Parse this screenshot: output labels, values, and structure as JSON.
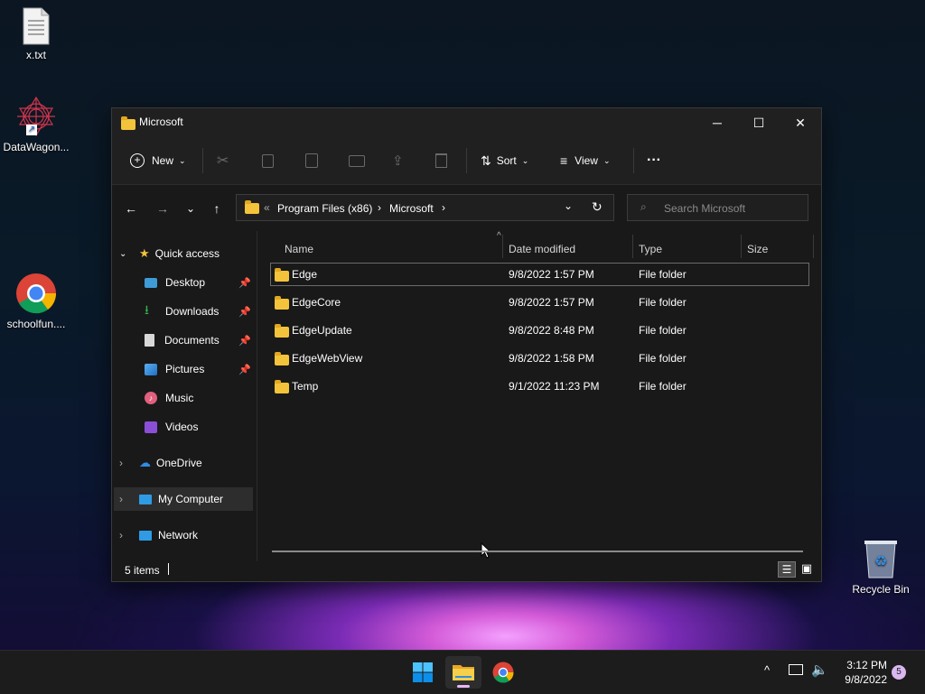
{
  "desktop": {
    "icons": [
      {
        "label": "x.txt",
        "icon": "text-file-icon"
      },
      {
        "label": "DataWagon...",
        "icon": "datawagon-shortcut-icon"
      },
      {
        "label": "schoolfun....",
        "icon": "chrome-icon"
      },
      {
        "label": "Recycle Bin",
        "icon": "recycle-bin-icon"
      }
    ]
  },
  "window": {
    "title": "Microsoft",
    "controls": {
      "minimize": "─",
      "maximize": "☐",
      "close": "✕"
    }
  },
  "commandbar": {
    "new_label": "New",
    "sort_label": "Sort",
    "view_label": "View",
    "more_label": "···"
  },
  "navigation": {
    "back": "←",
    "forward": "→",
    "recent": "⌄",
    "up": "↑",
    "breadcrumb": [
      "Program Files (x86)",
      "Microsoft"
    ],
    "overflow": "«",
    "search_placeholder": "Search Microsoft"
  },
  "sidebar": {
    "quick_access": "Quick access",
    "items": [
      {
        "label": "Desktop",
        "icon": "desktop-icon",
        "pinned": true
      },
      {
        "label": "Downloads",
        "icon": "downloads-icon",
        "pinned": true
      },
      {
        "label": "Documents",
        "icon": "documents-icon",
        "pinned": true
      },
      {
        "label": "Pictures",
        "icon": "pictures-icon",
        "pinned": true
      },
      {
        "label": "Music",
        "icon": "music-icon",
        "pinned": false
      },
      {
        "label": "Videos",
        "icon": "videos-icon",
        "pinned": false
      }
    ],
    "onedrive": "OneDrive",
    "mycomputer": "My Computer",
    "network": "Network"
  },
  "filelist": {
    "columns": [
      "Name",
      "Date modified",
      "Type",
      "Size"
    ],
    "rows": [
      {
        "name": "Edge",
        "date": "9/8/2022 1:57 PM",
        "type": "File folder",
        "size": ""
      },
      {
        "name": "EdgeCore",
        "date": "9/8/2022 1:57 PM",
        "type": "File folder",
        "size": ""
      },
      {
        "name": "EdgeUpdate",
        "date": "9/8/2022 8:48 PM",
        "type": "File folder",
        "size": ""
      },
      {
        "name": "EdgeWebView",
        "date": "9/8/2022 1:58 PM",
        "type": "File folder",
        "size": ""
      },
      {
        "name": "Temp",
        "date": "9/1/2022 11:23 PM",
        "type": "File folder",
        "size": ""
      }
    ]
  },
  "status": {
    "items_count": "5 items"
  },
  "taskbar": {
    "time": "3:12 PM",
    "date": "9/8/2022",
    "notification_count": "5"
  },
  "colors": {
    "accent": "#0078d4",
    "folder": "#f3c33b",
    "window_bg": "#191919"
  }
}
